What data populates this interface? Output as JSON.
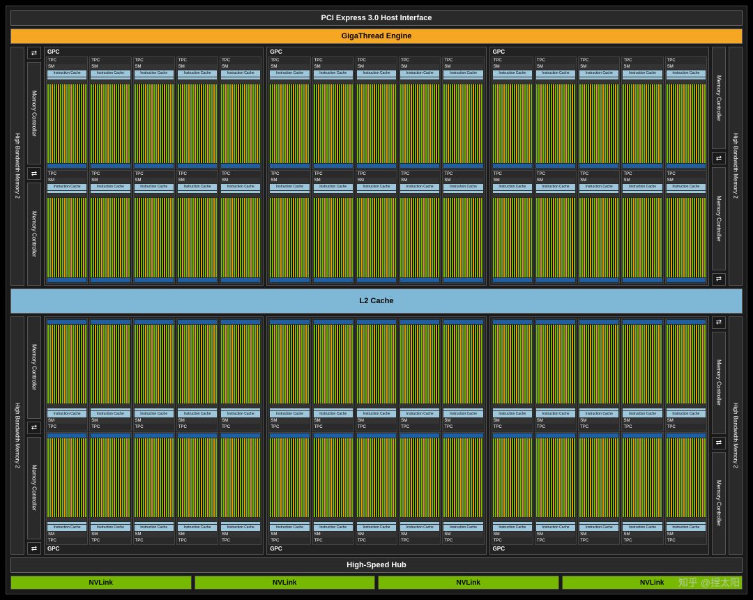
{
  "labels": {
    "pcie": "PCI Express 3.0 Host Interface",
    "gigathread": "GigaThread Engine",
    "l2": "L2 Cache",
    "highspeed": "High-Speed Hub",
    "nvlink": "NVLink",
    "gpc": "GPC",
    "tpc": "TPC",
    "sm": "SM",
    "icache": "Instruction Cache",
    "memctrl": "Memory Controller",
    "hbm": "High Bandwidth Memory 2",
    "watermark": "知乎 @捏太阳"
  },
  "layout": {
    "gpc_cols": 3,
    "gpc_rows_top": 1,
    "gpc_rows_bottom": 1,
    "tpc_per_gpc_row": 5,
    "tpc_rows_per_gpc": 2,
    "nvlink_count": 4,
    "memctrl_per_side": 4,
    "hbm_per_side": 2
  }
}
